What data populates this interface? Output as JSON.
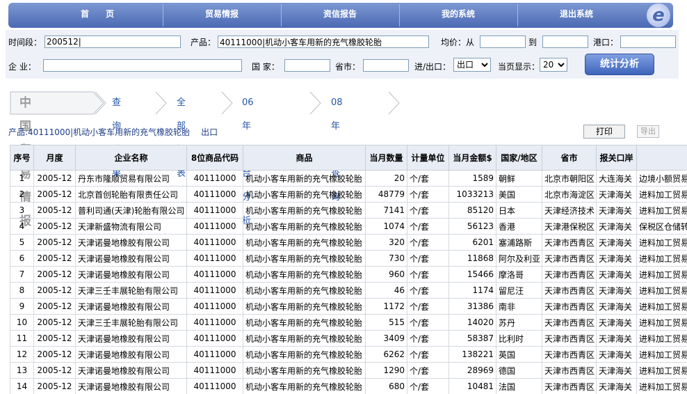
{
  "nav": {
    "items": [
      "首　　页",
      "贸易情报",
      "资信报告",
      "我的系统",
      "退出系统"
    ],
    "logo_glyph": "e"
  },
  "form": {
    "period_label": "时间段：",
    "period_value": "200512|",
    "product_label": "产品：",
    "product_value": "40111000|机动小客车用新的充气橡胶轮胎",
    "price_label": "均价：从",
    "price_to_label": "到",
    "port_label": "港口：",
    "company_label": "企 业：",
    "country_label": "国 家：",
    "province_label": "省市：",
    "io_label": "进/出口：",
    "io_value": "出口",
    "page_size_label": "当页显示：",
    "page_size_value": "20",
    "analyze_label": "统计分析"
  },
  "crumbs": {
    "brand": "中国贸易情报",
    "items": [
      "查询结果",
      "全部报表",
      "06年综合分析",
      "08年HS查询"
    ]
  },
  "product_line": {
    "text": "产品:40111000|机动小客车用新的充气橡胶轮胎",
    "direction": "出口"
  },
  "actions": {
    "print": "打印",
    "export": "导出"
  },
  "table": {
    "headers": [
      "序号",
      "月度",
      "企业名称",
      "8位商品代码",
      "商品",
      "当月数量",
      "计量单位",
      "当月金额$",
      "国家/地区",
      "省市",
      "报关口岸",
      ""
    ],
    "rows": [
      [
        "1",
        "2005-12",
        "丹东市隆顺贸易有限公司",
        "40111000",
        "机动小客车用新的充气橡胶轮胎",
        "20",
        "个/套",
        "1589",
        "朝鲜",
        "北京市朝阳区",
        "大连海关",
        "边境小额贸易"
      ],
      [
        "2",
        "2005-12",
        "北京首创轮胎有限责任公司",
        "40111000",
        "机动小客车用新的充气橡胶轮胎",
        "48779",
        "个/套",
        "1033213",
        "美国",
        "北京市海淀区",
        "天津海关",
        "进料加工贸易"
      ],
      [
        "3",
        "2005-12",
        "普利司通(天津)轮胎有限公司",
        "40111000",
        "机动小客车用新的充气橡胶轮胎",
        "7141",
        "个/套",
        "85120",
        "日本",
        "天津经济技术",
        "天津海关",
        "进料加工贸易"
      ],
      [
        "4",
        "2005-12",
        "天津新盛物流有限公司",
        "40111000",
        "机动小客车用新的充气橡胶轮胎",
        "1074",
        "个/套",
        "56123",
        "香港",
        "天津港保税区",
        "天津海关",
        "保税区仓储转口"
      ],
      [
        "5",
        "2005-12",
        "天津诺曼地橡胶有限公司",
        "40111000",
        "机动小客车用新的充气橡胶轮胎",
        "320",
        "个/套",
        "6201",
        "塞浦路斯",
        "天津市西青区",
        "天津海关",
        "进料加工贸易"
      ],
      [
        "6",
        "2005-12",
        "天津诺曼地橡胶有限公司",
        "40111000",
        "机动小客车用新的充气橡胶轮胎",
        "730",
        "个/套",
        "11868",
        "阿尔及利亚",
        "天津市西青区",
        "天津海关",
        "进料加工贸易"
      ],
      [
        "7",
        "2005-12",
        "天津诺曼地橡胶有限公司",
        "40111000",
        "机动小客车用新的充气橡胶轮胎",
        "960",
        "个/套",
        "15466",
        "摩洛哥",
        "天津市西青区",
        "天津海关",
        "进料加工贸易"
      ],
      [
        "8",
        "2005-12",
        "天津三壬丰展轮胎有限公司",
        "40111000",
        "机动小客车用新的充气橡胶轮胎",
        "46",
        "个/套",
        "1174",
        "留尼汪",
        "天津市西青区",
        "天津海关",
        "进料加工贸易"
      ],
      [
        "9",
        "2005-12",
        "天津诺曼地橡胶有限公司",
        "40111000",
        "机动小客车用新的充气橡胶轮胎",
        "1172",
        "个/套",
        "31386",
        "南非",
        "天津市西青区",
        "天津海关",
        "进料加工贸易"
      ],
      [
        "10",
        "2005-12",
        "天津三壬丰展轮胎有限公司",
        "40111000",
        "机动小客车用新的充气橡胶轮胎",
        "515",
        "个/套",
        "14020",
        "苏丹",
        "天津市西青区",
        "天津海关",
        "进料加工贸易"
      ],
      [
        "11",
        "2005-12",
        "天津诺曼地橡胶有限公司",
        "40111000",
        "机动小客车用新的充气橡胶轮胎",
        "3409",
        "个/套",
        "58387",
        "比利时",
        "天津市西青区",
        "天津海关",
        "进料加工贸易"
      ],
      [
        "12",
        "2005-12",
        "天津诺曼地橡胶有限公司",
        "40111000",
        "机动小客车用新的充气橡胶轮胎",
        "6262",
        "个/套",
        "138221",
        "英国",
        "天津市西青区",
        "天津海关",
        "进料加工贸易"
      ],
      [
        "13",
        "2005-12",
        "天津诺曼地橡胶有限公司",
        "40111000",
        "机动小客车用新的充气橡胶轮胎",
        "1290",
        "个/套",
        "28969",
        "德国",
        "天津市西青区",
        "天津海关",
        "进料加工贸易"
      ],
      [
        "14",
        "2005-12",
        "天津诺曼地橡胶有限公司",
        "40111000",
        "机动小客车用新的充气橡胶轮胎",
        "680",
        "个/套",
        "10481",
        "法国",
        "天津市西青区",
        "天津海关",
        "进料加工贸易"
      ]
    ]
  }
}
